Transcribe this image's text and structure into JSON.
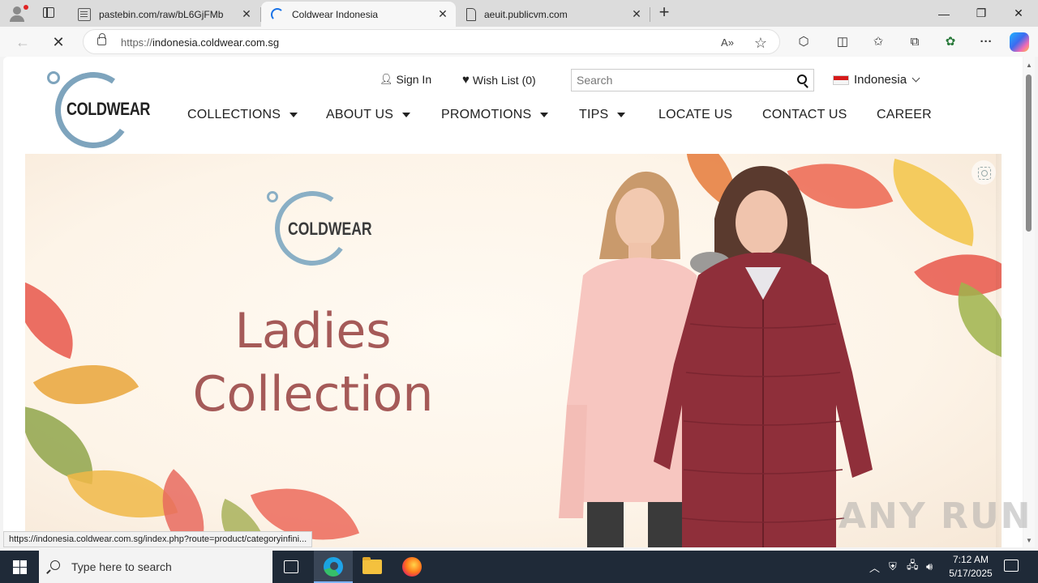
{
  "browser": {
    "tabs": [
      {
        "title": "pastebin.com/raw/bL6GjFMb",
        "icon": "page-icon"
      },
      {
        "title": "Coldwear Indonesia",
        "icon": "loading-spinner-icon"
      },
      {
        "title": "aeuit.publicvm.com",
        "icon": "document-icon"
      }
    ],
    "new_tab_symbol": "+",
    "window_controls": {
      "minimize": "—",
      "restore": "❐",
      "close": "✕"
    },
    "address": {
      "scheme": "https://",
      "host": "indonesia.coldwear.com.sg"
    },
    "nav_symbols": {
      "back": "←",
      "stop": "✕"
    },
    "toolbar_icons": {
      "read_aloud": "A»",
      "favorite": "☆",
      "extensions": "⬡",
      "split": "◫",
      "favorites": "✩",
      "collections": "⧉",
      "performance": "✿",
      "more": "···"
    }
  },
  "site": {
    "logo_text": "COLDWEAR",
    "sign_in": "Sign In",
    "wish_list": "Wish List (0)",
    "search_placeholder": "Search",
    "language": "Indonesia",
    "nav": [
      {
        "label": "COLLECTIONS",
        "dropdown": true
      },
      {
        "label": "ABOUT US",
        "dropdown": true
      },
      {
        "label": "PROMOTIONS",
        "dropdown": true
      },
      {
        "label": "TIPS",
        "dropdown": true
      },
      {
        "label": "LOCATE US",
        "dropdown": false
      },
      {
        "label": "CONTACT US",
        "dropdown": false
      },
      {
        "label": "CAREER",
        "dropdown": false
      }
    ],
    "hero": {
      "logo_text": "COLDWEAR",
      "headline_line1": "Ladies",
      "headline_line2": "Collection"
    }
  },
  "status_url": "https://indonesia.coldwear.com.sg/index.php?route=product/categoryinfini...",
  "watermark": "ANY RUN",
  "taskbar": {
    "search_placeholder": "Type here to search",
    "time": "7:12 AM",
    "date": "5/17/2025"
  },
  "colors": {
    "logo_ring": "#7ea4bd",
    "headline": "#a55a58",
    "taskbar": "#1f2a38",
    "flag_red": "#d61a1a"
  }
}
